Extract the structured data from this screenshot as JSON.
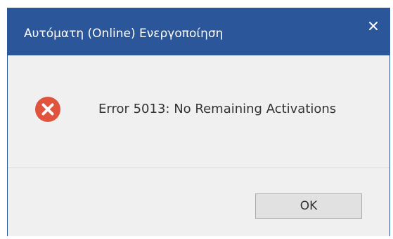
{
  "window": {
    "title": "Αυτόματη (Online) Ενεργοποίηση",
    "close_icon": "close-icon"
  },
  "message": {
    "icon": "error-icon",
    "text": "Error 5013: No Remaining Activations"
  },
  "buttons": {
    "ok_label": "OK"
  },
  "colors": {
    "titlebar": "#2b579a",
    "body": "#f0f0f0",
    "error": "#e0533d",
    "button": "#e1e1e1",
    "text": "#333333"
  }
}
